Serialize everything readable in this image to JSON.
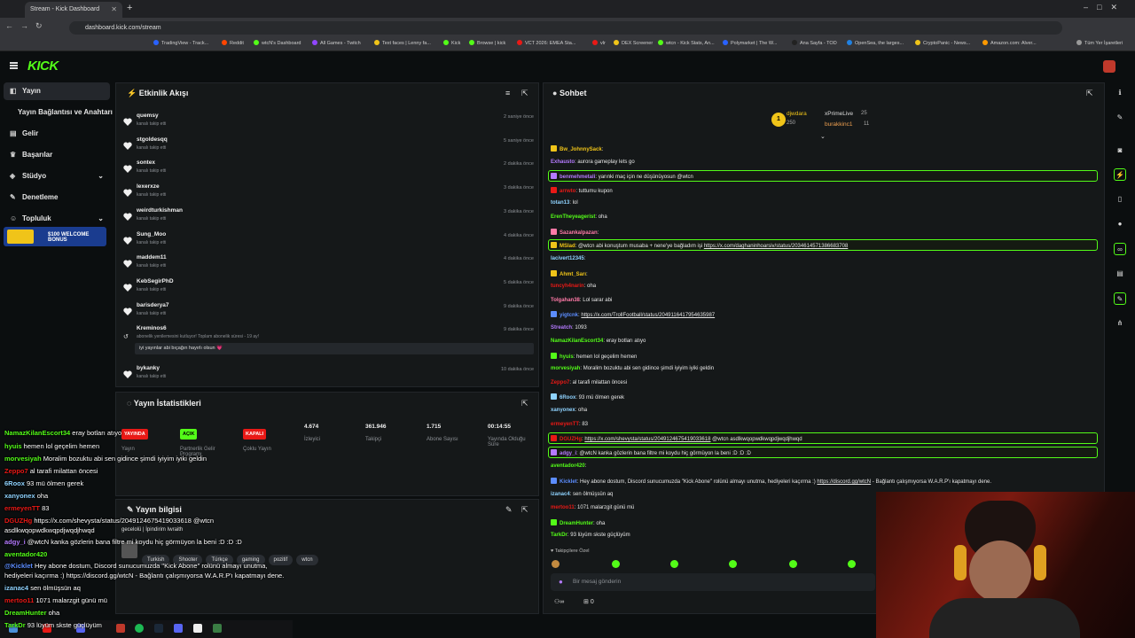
{
  "browser": {
    "tab_title": "Stream - Kick Dashboard",
    "url": "dashboard.kick.com/stream",
    "bookmarks": [
      "TradingView - Track...",
      "Reddit",
      "wtcN's Dashboard",
      "All Games - Twitch",
      "Text faces | Lenny fa...",
      "Kick",
      "Browse | kick",
      "VCT 2026: EMEA Sta...",
      "vlr",
      "DEX Screener",
      "wtcn - Kick Stats, An...",
      "Polymarket | The W...",
      "Ana Sayfa - TOD",
      "OpenSea, the larges...",
      "CryptoPanic - News...",
      "Amazon.com: Alver...",
      "Tüm Yer İşaretleri"
    ]
  },
  "brand": {
    "logo": "KICK",
    "accent": "#53fc18"
  },
  "sidebar": {
    "items": [
      {
        "label": "Yayın",
        "icon": "broadcast-icon"
      },
      {
        "label": "Yayın Bağlantısı ve Anahtarı",
        "icon": ""
      },
      {
        "label": "Gelir",
        "icon": "wallet-icon"
      },
      {
        "label": "Başarılar",
        "icon": "trophy-icon"
      },
      {
        "label": "Stüdyo",
        "icon": "studio-icon"
      },
      {
        "label": "Denetleme",
        "icon": "wrench-icon"
      },
      {
        "label": "Topluluk",
        "icon": "community-icon"
      }
    ],
    "promo_text": "$100 WELCOME BONUS"
  },
  "activity": {
    "title": "Etkinlik Akışı",
    "items": [
      {
        "name": "quemsy",
        "sub": "kanalı takip etti",
        "time": "2 saniye önce"
      },
      {
        "name": "stgoldesqq",
        "sub": "kanalı takip etti",
        "time": "5 saniye önce"
      },
      {
        "name": "sontex",
        "sub": "kanalı takip etti",
        "time": "2 dakika önce"
      },
      {
        "name": "lexerxze",
        "sub": "kanalı takip etti",
        "time": "3 dakika önce"
      },
      {
        "name": "weirdturkishman",
        "sub": "kanalı takip etti",
        "time": "3 dakika önce"
      },
      {
        "name": "Sung_Moo",
        "sub": "kanalı takip etti",
        "time": "4 dakika önce"
      },
      {
        "name": "maddem11",
        "sub": "kanalı takip etti",
        "time": "4 dakika önce"
      },
      {
        "name": "KebSegirPhD",
        "sub": "kanalı takip etti",
        "time": "5 dakika önce"
      },
      {
        "name": "barisderya7",
        "sub": "kanalı takip etti",
        "time": "9 dakika önce"
      }
    ],
    "sub_item": {
      "name": "Kreminos6",
      "sub": "abonelik yenilemesini kutluyor! Toplam abonelik süresi - 19 ay!",
      "time": "9 dakika önce",
      "message": "iyi yayınlar abi bıçağın hayırlı olsun 💗"
    },
    "last_item": {
      "name": "bykanky",
      "sub": "kanalı takip etti",
      "time": "10 dakika önce"
    }
  },
  "stats": {
    "title": "Yayın İstatistikleri",
    "cols": [
      {
        "badge": "YAYINDA",
        "label": "Yayın"
      },
      {
        "badge": "AÇIK",
        "label": "Partnerlik Gelir Programı"
      },
      {
        "badge": "KAPALI",
        "label": "Çoklu Yayın"
      },
      {
        "value": "4.674",
        "label": "İzleyici"
      },
      {
        "value": "361.946",
        "label": "Takipçi"
      },
      {
        "value": "1.715",
        "label": "Abone Sayısı"
      },
      {
        "value": "00:14:55",
        "label": "Yayında Olduğu Süre"
      }
    ]
  },
  "info": {
    "title": "Yayın bilgisi",
    "stream_title": "gecelolü | İpindirim Iwraith",
    "tags": [
      "Turkish",
      "Shooter",
      "Türkçe",
      "gaming",
      "pozitif",
      "wtcn"
    ]
  },
  "chat": {
    "title": "Sohbet",
    "top": [
      {
        "rank": "1",
        "name": "djwdara",
        "value": "250"
      },
      {
        "rank": "",
        "name": "xPrimeLive",
        "value": "25"
      },
      {
        "rank": "",
        "name": "burakkinc1",
        "value": "11"
      }
    ],
    "messages": [
      {
        "user": "Bw_JohnnySack",
        "text": ":",
        "color": "#f0c419"
      },
      {
        "user": "Exhausto",
        "text": ": aurora gameplay lets go",
        "color": "#b57aff"
      },
      {
        "user": "benmehmetali",
        "text": ": yarınki maç için ne düşünüyosun @wtcn",
        "color": "#b57aff",
        "hl": true
      },
      {
        "user": "arrwto",
        "text": ": tuttumu kupon",
        "color": "#e91916"
      },
      {
        "user": "totan13",
        "text": ": lol",
        "color": "#8fd3ff"
      },
      {
        "user": "ErenTheyeagerist",
        "text": ": oha",
        "color": "#53fc18"
      },
      {
        "user": "Sazankalpazan",
        "text": ":",
        "color": "#ff7aa8"
      },
      {
        "user": "MSlad",
        "text": ": @wtcn abi konuştum musaba + nene'ye bağladım işi ",
        "link": "https://x.com/daghaninhoarsiv/status/2034614571386683708",
        "color": "#f0c419",
        "hl": true
      },
      {
        "user": "lacivert12345",
        "text": ":",
        "color": "#8fd3ff"
      },
      {
        "user": "Ahmt_Sarı",
        "text": ":",
        "color": "#f0c419"
      },
      {
        "user": "tuncyh4narin",
        "text": ": oha",
        "color": "#e91916"
      },
      {
        "user": "Tolgahan38",
        "text": ": Lol sarar abi",
        "color": "#ff7aa8"
      },
      {
        "user": "yigtcnk",
        "text": ": ",
        "link": "https://x.com/TrollFootball/status/2049116417954635987",
        "color": "#5c8dff"
      },
      {
        "user": "Streatch",
        "text": ": 1093",
        "color": "#b57aff"
      },
      {
        "user": "NamazKilanEscort34",
        "text": ": eray botları atıyo",
        "color": "#53fc18"
      },
      {
        "user": "hyuis",
        "text": ": hemen lol geçelim hemen",
        "color": "#53fc18"
      },
      {
        "user": "morvesiyah",
        "text": ": Moralim bozuktu abi sen gidince şimdi iyiyim iyiki geldin",
        "color": "#53fc18"
      },
      {
        "user": "Zeppo7",
        "text": ": al tarafi milattan öncesi",
        "color": "#e91916"
      },
      {
        "user": "6Roox",
        "text": ": 93 mü ölmen gerek",
        "color": "#8fd3ff"
      },
      {
        "user": "xanyonex",
        "text": ": oha",
        "color": "#8fd3ff"
      },
      {
        "user": "ermeyenTT",
        "text": ": 83",
        "color": "#e91916"
      },
      {
        "user": "DGUZHg",
        "text": ": ",
        "link": "https://x.com/shevysta/status/2049124675419033618",
        "after": " @wtcn asdlkwqopwdkwqpdjwqdjhwqd",
        "color": "#e91916",
        "hl": true
      },
      {
        "user": "adgy_i",
        "text": ": @wtcN kanka gözlerin bana filtre mi koydu hiç görmüyon la beni :D :D :D",
        "color": "#b57aff",
        "hl": true
      },
      {
        "user": "aventador420",
        "text": ":",
        "color": "#53fc18"
      },
      {
        "user": "Kicklet",
        "text": ": Hey abone dostum, Discord sunucumuzda \"Kick Abone\" rolünü almayı unutma, hediyeleri kaçırma :) ",
        "link": "https://discord.gg/wtcN",
        "after": " - Bağlantı çalışmıyorsa W.A.R.P'ı kapatmayı dene.",
        "color": "#5c8dff"
      },
      {
        "user": "izanac4",
        "text": ": sen ölmüşsün aq",
        "color": "#8fd3ff"
      },
      {
        "user": "mertoo11",
        "text": ": 1071 malarzgit günü mü",
        "color": "#e91916"
      },
      {
        "user": "DreamHunter",
        "text": ": oha",
        "color": "#53fc18"
      },
      {
        "user": "TarkDr",
        "text": ": 93 lüyüm skste güçlüyüm",
        "color": "#53fc18"
      }
    ],
    "followers_only": "Takipçilere Özel",
    "input_placeholder": "Bir mesaj gönderin",
    "counter": "0"
  },
  "overlay_chat": [
    {
      "user": "NamazKilanEscort34",
      "text": " eray botları atıyo",
      "color": "#53fc18"
    },
    {
      "user": "hyuis",
      "text": " hemen lol geçelim hemen",
      "color": "#53fc18"
    },
    {
      "user": "morvesiyah",
      "text": " Moralim bozuktu abi sen gidince şimdi iyiyim iyiki geldin",
      "color": "#53fc18"
    },
    {
      "user": "Zeppo7",
      "text": " al tarafi milattan öncesi",
      "color": "#e91916"
    },
    {
      "user": "6Roox",
      "text": " 93 mü ölmen gerek",
      "color": "#8fd3ff"
    },
    {
      "user": "xanyonex",
      "text": " oha",
      "color": "#8fd3ff"
    },
    {
      "user": "ermeyenTT",
      "text": " 83",
      "color": "#e91916"
    },
    {
      "user": "DGUZHg",
      "text": " https://x.com/shevysta/status/2049124675419033618 @wtcn",
      "color": "#e91916"
    },
    {
      "user": "",
      "text": "asdlkwqopwdkwqpdjwqdjhwqd",
      "color": "#fff"
    },
    {
      "user": "adgy_i",
      "text": " @wtcN kanka gözlerin bana filtre mi koydu hiç görmüyon la beni :D :D :D",
      "color": "#b57aff"
    },
    {
      "user": "aventador420",
      "text": "",
      "color": "#53fc18"
    },
    {
      "user": "@Kicklet",
      "text": " Hey abone dostum, Discord sunucumuzda \"Kick Abone\" rolünü almayı unutma,",
      "color": "#5c8dff"
    },
    {
      "user": "",
      "text": "hediyeleri kaçırma :) https://discord.gg/wtcN - Bağlantı çalışmıyorsa W.A.R.P'ı kapatmayı dene.",
      "color": "#fff"
    },
    {
      "user": "izanac4",
      "text": " sen ölmüşsün aq",
      "color": "#8fd3ff"
    },
    {
      "user": "mertoo11",
      "text": " 1071 malarzgit günü mü",
      "color": "#e91916"
    },
    {
      "user": "DreamHunter",
      "text": " oha",
      "color": "#53fc18"
    },
    {
      "user": "TarkDr",
      "text": " 93 lüyüm skste güçlüyüm",
      "color": "#53fc18"
    }
  ]
}
